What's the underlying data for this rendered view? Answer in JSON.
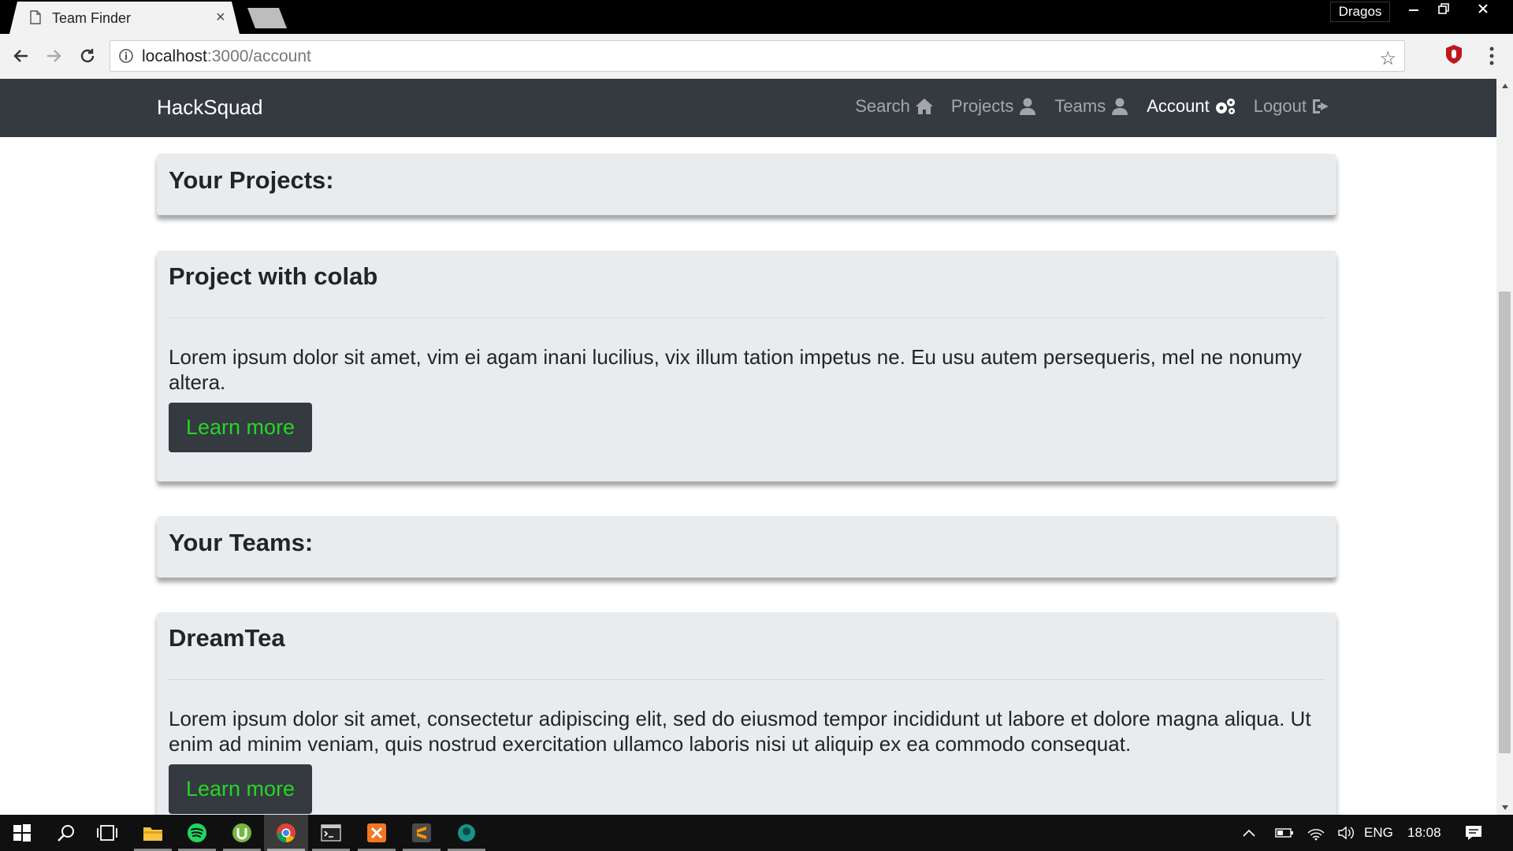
{
  "browser": {
    "tab_title": "Team Finder",
    "tab_close": "×",
    "profile_name": "Dragos",
    "url_host": "localhost",
    "url_rest": ":3000/account"
  },
  "site": {
    "brand": "HackSquad",
    "nav": [
      {
        "label": "Search",
        "icon": "home-icon",
        "active": false
      },
      {
        "label": "Projects",
        "icon": "user-icon",
        "active": false
      },
      {
        "label": "Teams",
        "icon": "user-icon",
        "active": false
      },
      {
        "label": "Account",
        "icon": "cogs-icon",
        "active": true
      },
      {
        "label": "Logout",
        "icon": "sign-out-icon",
        "active": false
      }
    ]
  },
  "content": {
    "projects_heading": "Your Projects:",
    "project": {
      "title": "Project with colab",
      "description": "Lorem ipsum dolor sit amet, vim ei agam inani lucilius, vix illum tation impetus ne. Eu usu autem persequeris, mel ne nonumy altera.",
      "button": "Learn more"
    },
    "teams_heading": "Your Teams:",
    "team": {
      "title": "DreamTea",
      "description": "Lorem ipsum dolor sit amet, consectetur adipiscing elit, sed do eiusmod tempor incididunt ut labore et dolore magna aliqua. Ut enim ad minim veniam, quis nostrud exercitation ullamco laboris nisi ut aliquip ex ea commodo consequat.",
      "button": "Learn more"
    }
  },
  "taskbar": {
    "language": "ENG",
    "time": "18:08"
  },
  "colors": {
    "navbar": "#343a40",
    "card": "#e9ecef",
    "button_text": "#28d428"
  }
}
